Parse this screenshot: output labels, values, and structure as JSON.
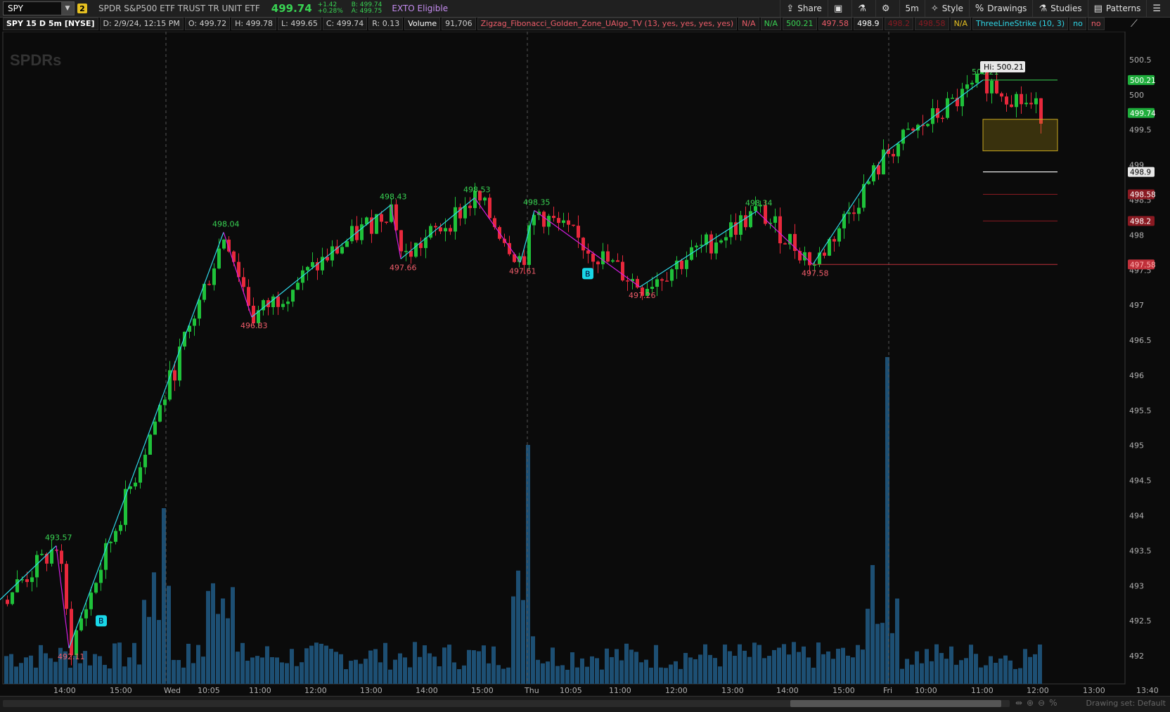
{
  "header": {
    "symbol": "SPY",
    "link_badge": "2",
    "description": "SPDR S&P500 ETF TRUST TR UNIT ETF",
    "last_price": "499.74",
    "change": "+1.42",
    "change_pct": "+0.28%",
    "bid": "B: 499.74",
    "ask": "A: 499.75",
    "exto": "EXTO Eligible"
  },
  "toolbar": {
    "share": "Share",
    "interval": "5m",
    "style": "Style",
    "drawings": "Drawings",
    "studies": "Studies",
    "patterns": "Patterns"
  },
  "info": {
    "title": "SPY 15 D 5m [NYSE]",
    "date": "D: 2/9/24, 12:15 PM",
    "open": "O: 499.72",
    "high": "H: 499.78",
    "low": "L: 499.65",
    "close": "C: 499.74",
    "range": "R: 0.13",
    "volume_label": "Volume",
    "volume_value": "91,706",
    "zigzag": "Zigzag_Fibonacci_Golden_Zone_UAlgo_TV (13, yes, yes, yes, yes)",
    "na1": "N/A",
    "na2": "N/A",
    "v1": "500.21",
    "v2": "497.58",
    "v3": "498.9",
    "v4": "498.2",
    "v5": "498.58",
    "na3": "N/A",
    "tls": "ThreeLineStrike (10, 3)",
    "no1": "no",
    "no2": "no"
  },
  "colors": {
    "up": "#1fc23a",
    "down": "#e8283c",
    "zig": "#2fd8e8",
    "zig2": "#d21ee0",
    "volume": "#1d4f73",
    "hiLabel": "#39d353",
    "loLabel": "#ef5d6a"
  },
  "chart_data": {
    "type": "candlestick",
    "ylim": [
      491.6,
      500.9
    ],
    "yticks": [
      "500.5",
      "500",
      "499.5",
      "499",
      "498.5",
      "498",
      "497.5",
      "497",
      "496.5",
      "496",
      "495.5",
      "495",
      "494.5",
      "494",
      "493.5",
      "493",
      "492.5",
      "492"
    ],
    "xticks": [
      "14:00",
      "15:00",
      "Wed",
      "10:05",
      "11:00",
      "12:00",
      "13:00",
      "14:00",
      "15:00",
      "Thu",
      "10:05",
      "11:00",
      "12:00",
      "13:00",
      "14:00",
      "15:00",
      "Fri",
      "10:00",
      "11:00",
      "12:00",
      "13:00",
      "13:40"
    ],
    "price_markers": [
      {
        "label": "500.21",
        "value": 500.21,
        "bg": "#1fae3c",
        "fg": "#fff"
      },
      {
        "label": "499.74",
        "value": 499.74,
        "bg": "#1fae3c",
        "fg": "#fff"
      },
      {
        "label": "498.9",
        "value": 498.9,
        "bg": "#e8e8e8",
        "fg": "#000"
      },
      {
        "label": "498.58",
        "value": 498.58,
        "bg": "#8a1a22",
        "fg": "#fff"
      },
      {
        "label": "498.2",
        "value": 498.2,
        "bg": "#8a1a22",
        "fg": "#fff"
      },
      {
        "label": "497.58",
        "value": 497.58,
        "bg": "#c0303a",
        "fg": "#ffb0b0"
      }
    ],
    "hi_label": "Hi: 500.21",
    "pivot_labels": [
      {
        "text": "493.57",
        "type": "high"
      },
      {
        "text": "492.11",
        "type": "low"
      },
      {
        "text": "498.04",
        "type": "high"
      },
      {
        "text": "496.83",
        "type": "low"
      },
      {
        "text": "498.43",
        "type": "high"
      },
      {
        "text": "497.66",
        "type": "low"
      },
      {
        "text": "498.53",
        "type": "high"
      },
      {
        "text": "497.61",
        "type": "low"
      },
      {
        "text": "498.35",
        "type": "high"
      },
      {
        "text": "497.26",
        "type": "low"
      },
      {
        "text": "498.34",
        "type": "high"
      },
      {
        "text": "497.58",
        "type": "low"
      },
      {
        "text": "500.21",
        "type": "high"
      }
    ],
    "buy_signal": "B"
  },
  "bottom": {
    "drawing_set": "Drawing set: Default"
  }
}
